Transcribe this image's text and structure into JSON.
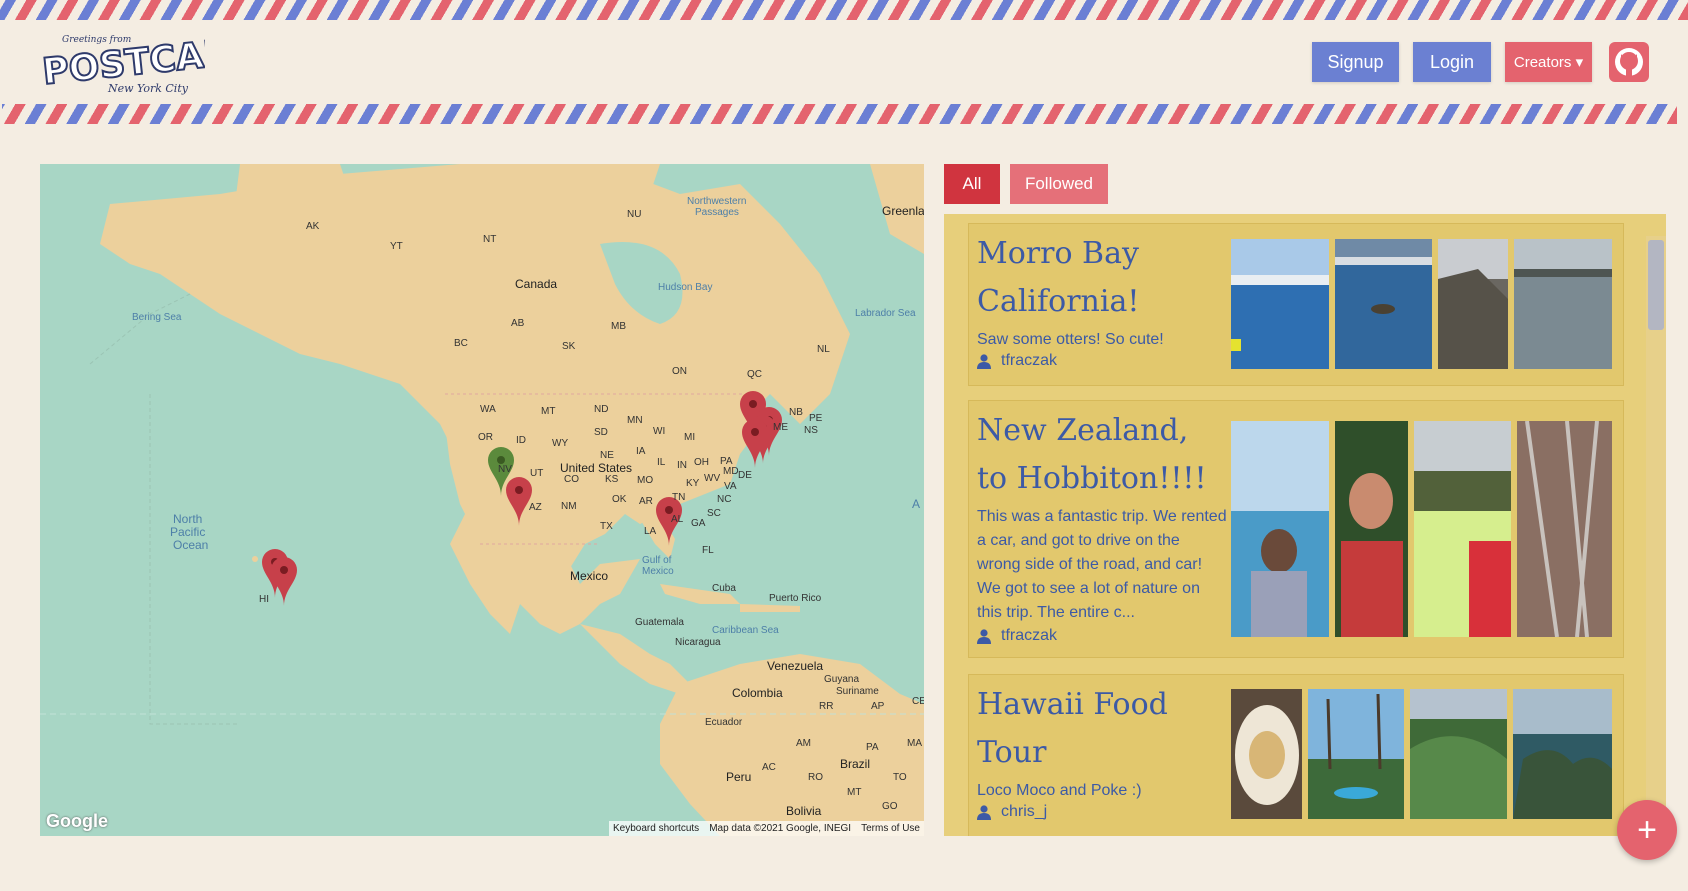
{
  "header": {
    "logo_top": "Greetings from",
    "logo_main": "POSTCARD",
    "logo_sub": "New York City",
    "signup_label": "Signup",
    "login_label": "Login",
    "creators_label": "Creators ▾"
  },
  "map": {
    "labels": {
      "greenland": "Greenlar",
      "northwestern": "Northwestern",
      "passages": "Passages",
      "canada": "Canada",
      "hudson": "Hudson Bay",
      "labrador": "Labrador Sea",
      "bering": "Bering Sea",
      "us": "United States",
      "mexico": "Mexico",
      "npo1": "North",
      "npo2": "Pacific",
      "npo3": "Ocean",
      "gulf1": "Gulf of",
      "gulf2": "Mexico",
      "cuba": "Cuba",
      "pr": "Puerto Rico",
      "guatemala": "Guatemala",
      "nicaragua": "Nicaragua",
      "caribbean": "Caribbean Sea",
      "venezuela": "Venezuela",
      "guyana": "Guyana",
      "suriname": "Suriname",
      "colombia": "Colombia",
      "ecuador": "Ecuador",
      "peru": "Peru",
      "brazil": "Brazil",
      "bolivia": "Bolivia",
      "ak": "AK",
      "yt": "YT",
      "nt": "NT",
      "nu": "NU",
      "ab": "AB",
      "mb": "MB",
      "sk": "SK",
      "bc": "BC",
      "on": "ON",
      "qc": "QC",
      "nl": "NL",
      "nb": "NB",
      "pe": "PE",
      "ns": "NS",
      "wa": "WA",
      "mt": "MT",
      "nd": "ND",
      "mn": "MN",
      "or": "OR",
      "id": "ID",
      "wy": "WY",
      "sd": "SD",
      "wi": "WI",
      "mi": "MI",
      "ne": "NE",
      "ia": "IA",
      "nv": "NV",
      "ut": "UT",
      "co": "CO",
      "ks": "KS",
      "mo": "MO",
      "il": "IL",
      "in": "IN",
      "oh": "OH",
      "pa": "PA",
      "md": "MD",
      "de": "DE",
      "wv": "WV",
      "va": "VA",
      "ky": "KY",
      "tn": "TN",
      "nc": "NC",
      "sc": "SC",
      "az": "AZ",
      "nm": "NM",
      "ok": "OK",
      "ar": "AR",
      "tx": "TX",
      "la": "LA",
      "al": "AL",
      "ga": "GA",
      "fl": "FL",
      "hi": "HI",
      "me": "ME",
      "rr": "RR",
      "ap": "AP",
      "am": "AM",
      "pa2": "PA",
      "ma": "MA",
      "ac": "AC",
      "ro": "RO",
      "to": "TO",
      "mt2": "MT",
      "go": "GO",
      "ce": "CE",
      "atl": "A"
    },
    "google": "Google",
    "attribution": {
      "keyboard": "Keyboard shortcuts",
      "data": "Map data ©2021 Google, INEGI",
      "terms": "Terms of Use"
    }
  },
  "feed": {
    "tab_all": "All",
    "tab_followed": "Followed",
    "cards": [
      {
        "title": "Morro Bay California!",
        "description": "Saw some otters! So cute!",
        "user": "tfraczak"
      },
      {
        "title": "New Zealand, to Hobbiton!!!!",
        "description": "This was a fantastic trip. We rented a car, and got to drive on the wrong side of the road, and car! We got to see a lot of nature on this trip. The entire c...",
        "user": "tfraczak"
      },
      {
        "title": "Hawaii Food Tour",
        "description": "Loco Moco and Poke :)",
        "user": "chris_j"
      }
    ]
  },
  "fab_label": "+",
  "colors": {
    "stripe_red": "#e4636e",
    "stripe_blue": "#6b7fd4",
    "accent_blue": "#6b80d2",
    "accent_red": "#d0343f",
    "feed_bg": "#e7cf7b",
    "text_blue": "#3c5aa6"
  }
}
